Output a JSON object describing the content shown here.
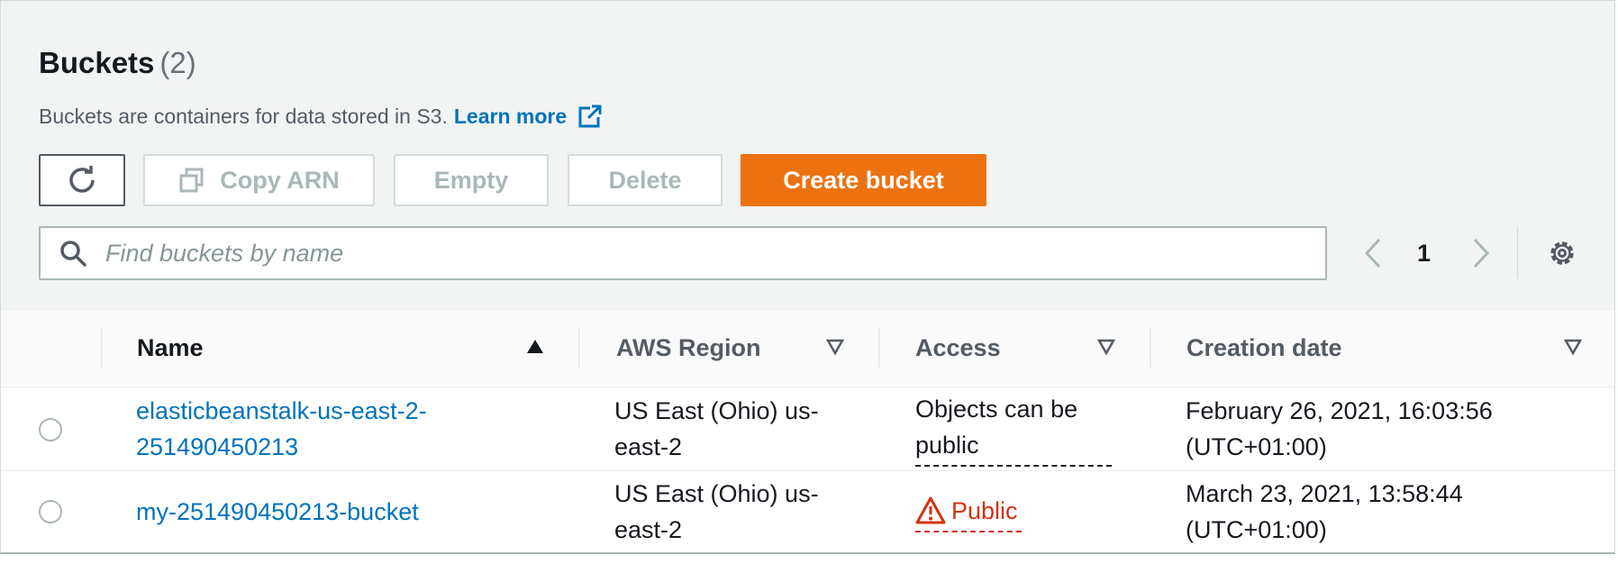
{
  "header": {
    "title": "Buckets",
    "count": "(2)",
    "description": "Buckets are containers for data stored in S3.",
    "learn_more": "Learn more"
  },
  "toolbar": {
    "refresh_icon": "refresh-icon",
    "copy_arn_label": "Copy ARN",
    "empty_label": "Empty",
    "delete_label": "Delete",
    "create_bucket_label": "Create bucket"
  },
  "search": {
    "placeholder": "Find buckets by name",
    "value": ""
  },
  "pagination": {
    "current_page": "1"
  },
  "table": {
    "columns": [
      "Name",
      "AWS Region",
      "Access",
      "Creation date"
    ],
    "rows": [
      {
        "name_line1": "elasticbeanstalk-us-east-2-",
        "name_line2": "251490450213",
        "region_line1": "US East (Ohio) us-",
        "region_line2": "east-2",
        "access_line1": "Objects can be",
        "access_line2": "public",
        "date_line1": "February 26, 2021, 16:03:56",
        "date_line2": "(UTC+01:00)"
      },
      {
        "name": "my-251490450213-bucket",
        "region_line1": "US East (Ohio) us-",
        "region_line2": "east-2",
        "access": "Public",
        "date_line1": "March 23, 2021, 13:58:44",
        "date_line2": "(UTC+01:00)"
      }
    ]
  },
  "colors": {
    "primary": "#ec7211",
    "link": "#0073bb",
    "warning": "#d13212"
  }
}
